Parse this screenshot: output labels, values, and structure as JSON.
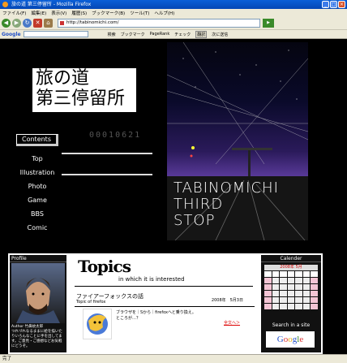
{
  "window": {
    "title": "旅の道 第三停留所 - Mozilla Firefox",
    "buttons": [
      "_",
      "□",
      "×"
    ]
  },
  "menu": [
    "ファイル(F)",
    "編集(E)",
    "表示(V)",
    "履歴(S)",
    "ブックマーク(B)",
    "ツール(T)",
    "ヘルプ(H)"
  ],
  "nav": {
    "url": "http://tabinomichi.com/"
  },
  "google_toolbar": {
    "logo": "Google",
    "items": [
      "検索",
      "ブックマーク",
      "PageRank",
      "チェック",
      "翻訳",
      "次に送信"
    ]
  },
  "site": {
    "logo_line1": "旅の道",
    "logo_line2": "第三停留所",
    "contents_label": "Contents",
    "counter": "00010621",
    "menu": [
      "Top",
      "Illustration",
      "Photo",
      "Game",
      "BBS",
      "Comic"
    ],
    "photo_text": [
      "TABINOMICHI",
      "THIRD",
      "STOP"
    ]
  },
  "profile": {
    "heading": "Profile",
    "author_label": "Author",
    "author_name": "竹鼻蚊太郎",
    "bio": "つれづれなるままに絵を描いたりいろんなことに手を出してます。ご意見・ご感想などお気軽にどうぞ。"
  },
  "topics": {
    "title": "Topics",
    "subtitle": "in which it is interested",
    "article_title": "ファイアーフォックスの話",
    "article_topic": "Topic of firefox",
    "article_date": "2008年　5月3日",
    "article_text": "ブラウザを｜Sから｜firefoxへと乗り換え。ところが…？",
    "read_more": "全文へ＞"
  },
  "sidebar": {
    "calendar_heading": "Calender",
    "calendar_title": "2008年 5月",
    "search_heading": "Search in a site",
    "google_label": "Google"
  },
  "status": {
    "text": "完了"
  },
  "colors": {
    "page_bg": "#000000",
    "accent_red": "#dd0000",
    "calendar_pink": "#f4c4d4"
  }
}
